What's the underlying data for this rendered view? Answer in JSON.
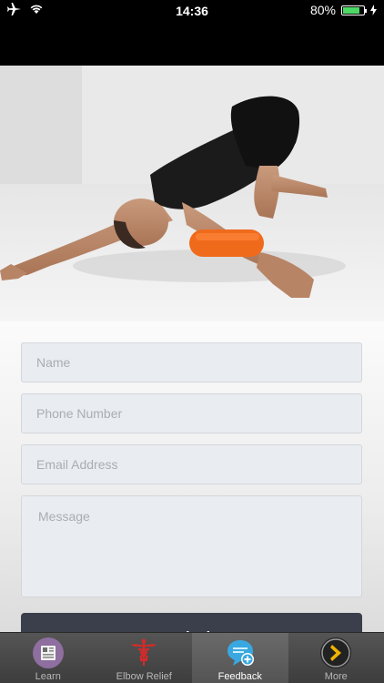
{
  "status_bar": {
    "time": "14:36",
    "battery_percent": "80%",
    "battery_level": 0.8
  },
  "form": {
    "name_placeholder": "Name",
    "phone_placeholder": "Phone Number",
    "email_placeholder": "Email Address",
    "message_placeholder": "Message",
    "submit_label": "Submit"
  },
  "tab_bar": {
    "items": [
      {
        "label": "Learn",
        "icon": "book-icon"
      },
      {
        "label": "Elbow Relief",
        "icon": "caduceus-icon"
      },
      {
        "label": "Feedback",
        "icon": "chat-add-icon"
      },
      {
        "label": "More",
        "icon": "chevron-right-icon"
      }
    ],
    "active_index": 2
  },
  "colors": {
    "accent_blue": "#3aa8e0",
    "submit_bg": "#3a3f4b",
    "battery_green": "#4cd964",
    "foam_roller": "#f06a1c"
  }
}
